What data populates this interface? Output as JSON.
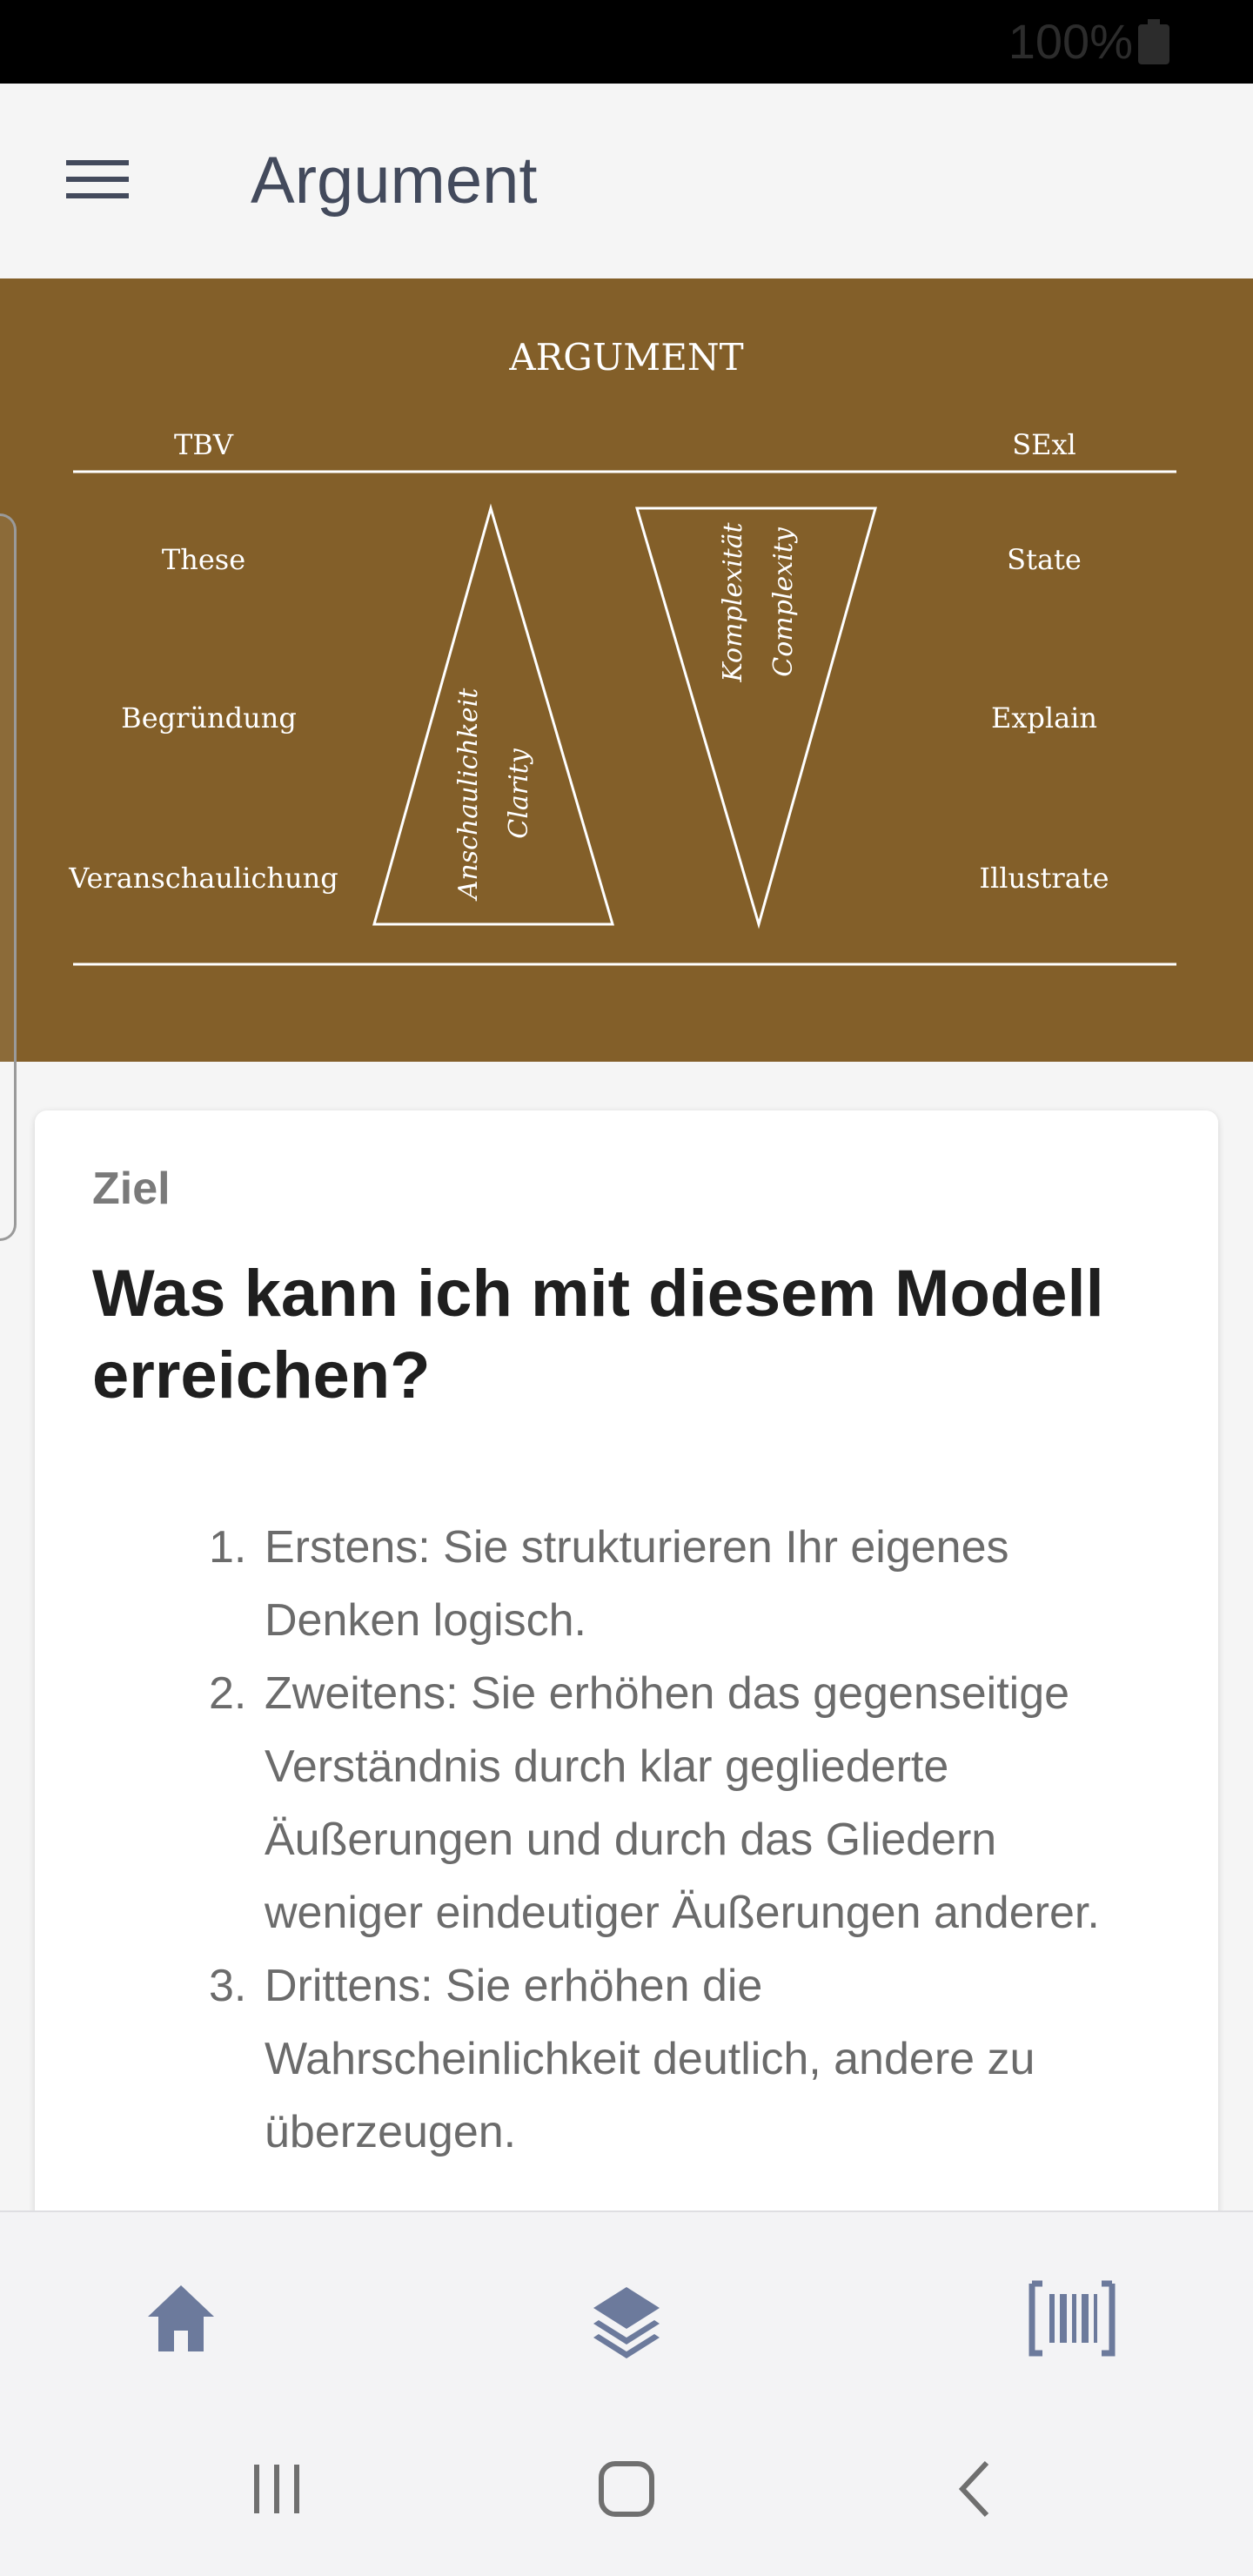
{
  "status_bar": {
    "battery_text": "100%",
    "icons": [
      "battery-icon"
    ]
  },
  "app_bar": {
    "title": "Argument",
    "menu_icon": "hamburger-menu-icon"
  },
  "diagram": {
    "title": "ARGUMENT",
    "left_header": "TBV",
    "right_header": "SExl",
    "left_labels": [
      "These",
      "Begründung",
      "Veranschaulichung"
    ],
    "right_labels": [
      "State",
      "Explain",
      "Illustrate"
    ],
    "triangle_up_labels": [
      "Anschaulichkeit",
      "Clarity"
    ],
    "triangle_down_labels": [
      "Komplexität",
      "Complexity"
    ],
    "colors": {
      "background": "#835f29",
      "ink": "#ffffff"
    }
  },
  "card": {
    "kicker": "Ziel",
    "heading": "Was kann ich mit diesem Modell erreichen?",
    "items": [
      {
        "num": "1.",
        "text": "Erstens: Sie strukturieren Ihr eigenes Denken logisch."
      },
      {
        "num": "2.",
        "text": "Zweitens: Sie erhöhen das gegenseitige Verständnis durch klar gegliederte Äußerungen und durch das Gliedern weniger eindeutiger Äußerungen anderer."
      },
      {
        "num": "3.",
        "text": "Drittens: Sie erhöhen die Wahrscheinlichkeit deutlich, andere zu überzeugen."
      }
    ]
  },
  "bottom_nav": {
    "items": [
      "home-icon",
      "layers-icon",
      "barcode-icon"
    ],
    "icon_color": "#6c7a9c"
  },
  "system_nav": {
    "items": [
      "recents-icon",
      "home-circle-icon",
      "back-icon"
    ]
  }
}
